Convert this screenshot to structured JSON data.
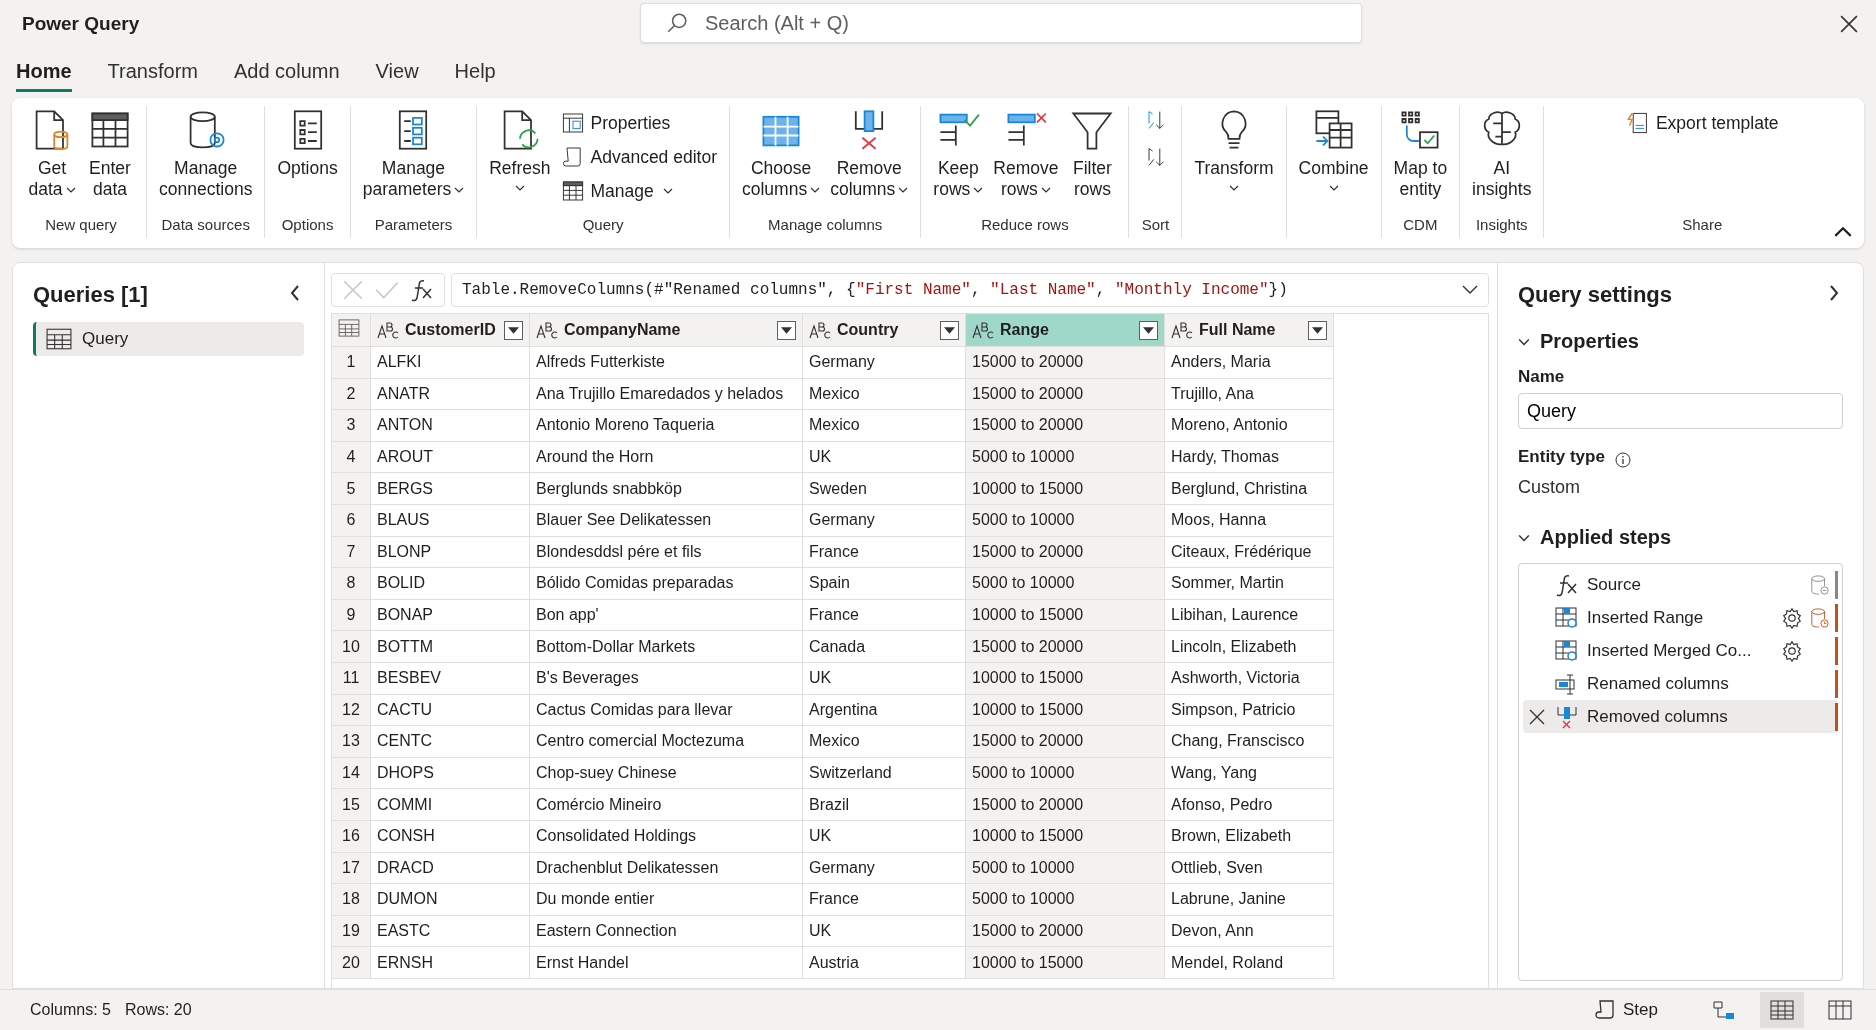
{
  "window": {
    "title": "Power Query",
    "search_placeholder": "Search (Alt + Q)"
  },
  "tabs": [
    {
      "label": "Home",
      "selected": true
    },
    {
      "label": "Transform",
      "selected": false
    },
    {
      "label": "Add column",
      "selected": false
    },
    {
      "label": "View",
      "selected": false
    },
    {
      "label": "Help",
      "selected": false
    }
  ],
  "ribbon": {
    "groups": [
      {
        "label": "New query",
        "items": [
          {
            "kind": "large",
            "label": "Get\ndata",
            "dropdown": true
          },
          {
            "kind": "large",
            "label": "Enter\ndata",
            "dropdown": false
          }
        ]
      },
      {
        "label": "Data sources",
        "items": [
          {
            "kind": "large",
            "label": "Manage\nconnections",
            "dropdown": false
          }
        ]
      },
      {
        "label": "Options",
        "items": [
          {
            "kind": "large",
            "label": "Options",
            "dropdown": false
          }
        ]
      },
      {
        "label": "Parameters",
        "items": [
          {
            "kind": "large",
            "label": "Manage\nparameters",
            "dropdown": true
          }
        ]
      },
      {
        "label": "Query",
        "items": [
          {
            "kind": "large",
            "label": "Refresh",
            "dropdown": true
          },
          {
            "kind": "small",
            "label": "Properties",
            "dropdown": false
          },
          {
            "kind": "small",
            "label": "Advanced editor",
            "dropdown": false
          },
          {
            "kind": "small",
            "label": "Manage",
            "dropdown": true
          }
        ]
      },
      {
        "label": "Manage columns",
        "items": [
          {
            "kind": "large",
            "label": "Choose\ncolumns",
            "dropdown": true
          },
          {
            "kind": "large",
            "label": "Remove\ncolumns",
            "dropdown": true
          }
        ]
      },
      {
        "label": "Reduce rows",
        "items": [
          {
            "kind": "large",
            "label": "Keep\nrows",
            "dropdown": true
          },
          {
            "kind": "large",
            "label": "Remove\nrows",
            "dropdown": true
          },
          {
            "kind": "large",
            "label": "Filter\nrows",
            "dropdown": false
          }
        ]
      },
      {
        "label": "Sort",
        "items": [
          {
            "kind": "icon"
          },
          {
            "kind": "icon"
          }
        ]
      },
      {
        "items": [
          {
            "kind": "large",
            "label": "Transform",
            "dropdown": true
          }
        ]
      },
      {
        "items": [
          {
            "kind": "large",
            "label": "Combine",
            "dropdown": true
          }
        ]
      },
      {
        "label": "CDM",
        "items": [
          {
            "kind": "large",
            "label": "Map to\nentity",
            "dropdown": false
          }
        ]
      },
      {
        "label": "Insights",
        "items": [
          {
            "kind": "large",
            "label": "AI\ninsights",
            "dropdown": false
          }
        ]
      },
      {
        "label": "Share",
        "items": [
          {
            "kind": "small",
            "label": "Export template",
            "dropdown": false
          }
        ]
      }
    ]
  },
  "queries_panel": {
    "title": "Queries [1]",
    "items": [
      {
        "label": "Query",
        "selected": true
      }
    ]
  },
  "formula": {
    "segments": [
      {
        "kind": "code",
        "text": "Table.RemoveColumns(#\"Renamed columns\", {"
      },
      {
        "kind": "string",
        "text": "\"First Name\""
      },
      {
        "kind": "code",
        "text": ", "
      },
      {
        "kind": "string",
        "text": "\"Last Name\""
      },
      {
        "kind": "code",
        "text": ", "
      },
      {
        "kind": "string",
        "text": "\"Monthly Income\""
      },
      {
        "kind": "code",
        "text": "})"
      }
    ]
  },
  "table": {
    "columns": [
      {
        "name": "CustomerID",
        "selected": false
      },
      {
        "name": "CompanyName",
        "selected": false
      },
      {
        "name": "Country",
        "selected": false
      },
      {
        "name": "Range",
        "selected": true
      },
      {
        "name": "Full Name",
        "selected": false
      }
    ],
    "rows": [
      {
        "num": "1",
        "cells": [
          "ALFKI",
          "Alfreds Futterkiste",
          "Germany",
          "15000 to 20000",
          "Anders, Maria"
        ]
      },
      {
        "num": "2",
        "cells": [
          "ANATR",
          "Ana Trujillo Emaredados y helados",
          "Mexico",
          "15000 to 20000",
          "Trujillo, Ana"
        ]
      },
      {
        "num": "3",
        "cells": [
          "ANTON",
          "Antonio Moreno Taqueria",
          "Mexico",
          "15000 to 20000",
          "Moreno, Antonio"
        ]
      },
      {
        "num": "4",
        "cells": [
          "AROUT",
          "Around the Horn",
          "UK",
          "5000 to 10000",
          "Hardy, Thomas"
        ]
      },
      {
        "num": "5",
        "cells": [
          "BERGS",
          "Berglunds snabbköp",
          "Sweden",
          "10000 to 15000",
          "Berglund, Christina"
        ]
      },
      {
        "num": "6",
        "cells": [
          "BLAUS",
          "Blauer See Delikatessen",
          "Germany",
          "5000 to 10000",
          "Moos, Hanna"
        ]
      },
      {
        "num": "7",
        "cells": [
          "BLONP",
          "Blondesddsl pére et fils",
          "France",
          "15000 to 20000",
          "Citeaux, Frédérique"
        ]
      },
      {
        "num": "8",
        "cells": [
          "BOLID",
          "Bólido Comidas preparadas",
          "Spain",
          "5000 to 10000",
          "Sommer, Martin"
        ]
      },
      {
        "num": "9",
        "cells": [
          "BONAP",
          "Bon app'",
          "France",
          "10000 to 15000",
          "Libihan, Laurence"
        ]
      },
      {
        "num": "10",
        "cells": [
          "BOTTM",
          "Bottom-Dollar Markets",
          "Canada",
          "15000 to 20000",
          "Lincoln, Elizabeth"
        ]
      },
      {
        "num": "11",
        "cells": [
          "BESBEV",
          "B's Beverages",
          "UK",
          "10000 to 15000",
          "Ashworth, Victoria"
        ]
      },
      {
        "num": "12",
        "cells": [
          "CACTU",
          "Cactus Comidas para llevar",
          "Argentina",
          "10000 to 15000",
          "Simpson, Patricio"
        ]
      },
      {
        "num": "13",
        "cells": [
          "CENTC",
          "Centro comercial Moctezuma",
          "Mexico",
          "15000 to 20000",
          "Chang, Franscisco"
        ]
      },
      {
        "num": "14",
        "cells": [
          "DHOPS",
          "Chop-suey Chinese",
          "Switzerland",
          "5000 to 10000",
          "Wang, Yang"
        ]
      },
      {
        "num": "15",
        "cells": [
          "COMMI",
          "Comércio Mineiro",
          "Brazil",
          "15000 to 20000",
          "Afonso, Pedro"
        ]
      },
      {
        "num": "16",
        "cells": [
          "CONSH",
          "Consolidated Holdings",
          "UK",
          "10000 to 15000",
          "Brown, Elizabeth"
        ]
      },
      {
        "num": "17",
        "cells": [
          "DRACD",
          "Drachenblut Delikatessen",
          "Germany",
          "5000 to 10000",
          "Ottlieb, Sven"
        ]
      },
      {
        "num": "18",
        "cells": [
          "DUMON",
          "Du monde entier",
          "France",
          "5000 to 10000",
          "Labrune, Janine"
        ]
      },
      {
        "num": "19",
        "cells": [
          "EASTC",
          "Eastern Connection",
          "UK",
          "15000 to 20000",
          "Devon, Ann"
        ]
      },
      {
        "num": "20",
        "cells": [
          "ERNSH",
          "Ernst Handel",
          "Austria",
          "10000 to 15000",
          "Mendel, Roland"
        ]
      }
    ]
  },
  "settings": {
    "title": "Query settings",
    "properties_heading": "Properties",
    "name_label": "Name",
    "name_value": "Query",
    "entity_type_label": "Entity type",
    "entity_type_value": "Custom",
    "steps_heading": "Applied steps",
    "steps": [
      {
        "label": "Source",
        "kind": "formula",
        "settings": false,
        "db_icon": true,
        "db_warning": false,
        "color": "#8a8886",
        "selected": false
      },
      {
        "label": "Inserted Range",
        "kind": "table",
        "settings": true,
        "db_icon": true,
        "db_warning": true,
        "color": "#c4501b",
        "selected": false
      },
      {
        "label": "Inserted Merged Co...",
        "kind": "table",
        "settings": true,
        "db_icon": false,
        "color": "#c4501b",
        "selected": false
      },
      {
        "label": "Renamed columns",
        "kind": "rename",
        "settings": false,
        "db_icon": false,
        "color": "#c4501b",
        "selected": false
      },
      {
        "label": "Removed columns",
        "kind": "remove",
        "settings": false,
        "db_icon": false,
        "color": "#c4501b",
        "selected": true
      }
    ]
  },
  "status_bar": {
    "columns": "Columns: 5",
    "rows": "Rows: 20",
    "step_label": "Step",
    "views": [
      {
        "selected": false
      },
      {
        "selected": true
      },
      {
        "selected": false
      }
    ]
  }
}
